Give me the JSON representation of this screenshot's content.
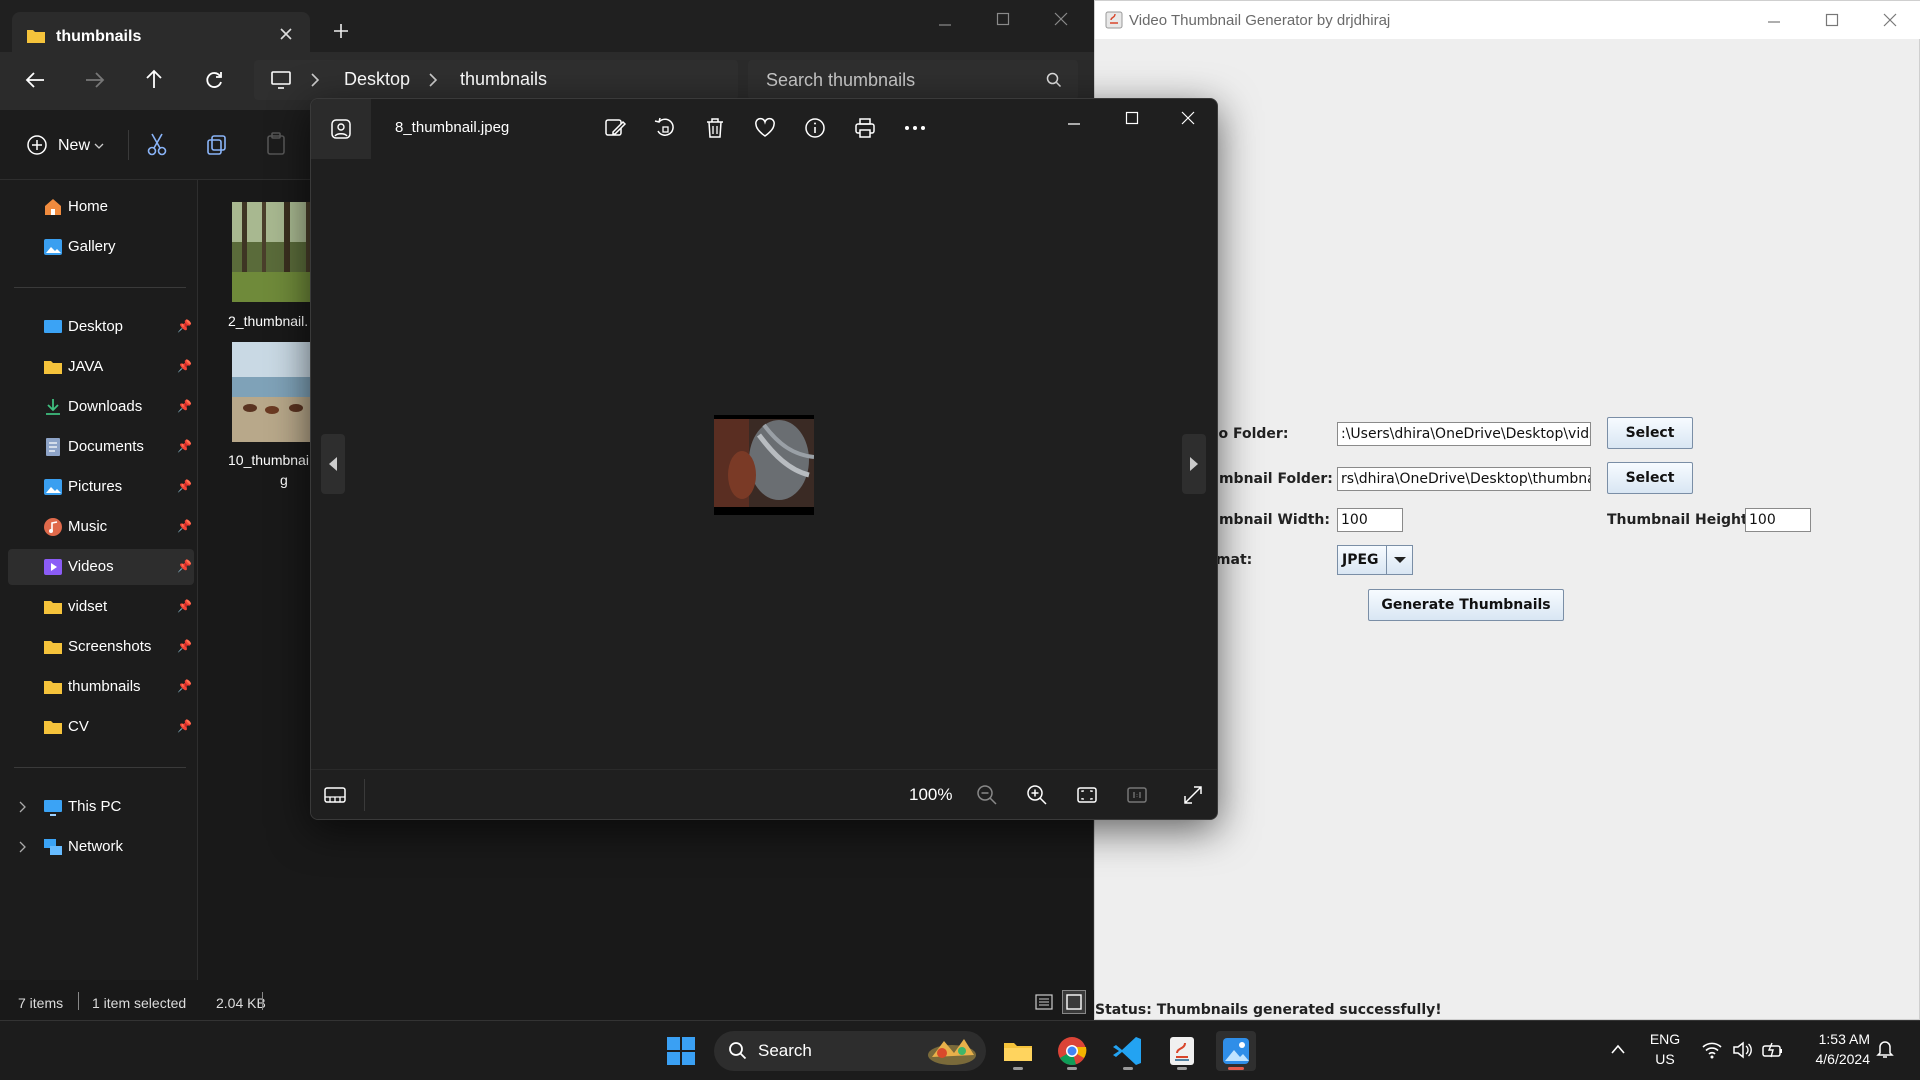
{
  "explorer": {
    "tab_title": "thumbnails",
    "breadcrumb": [
      "Desktop",
      "thumbnails"
    ],
    "search_placeholder": "Search thumbnails",
    "new_label": "New",
    "sidebar": {
      "top": [
        {
          "label": "Home",
          "icon": "home-icon"
        },
        {
          "label": "Gallery",
          "icon": "gallery-icon"
        }
      ],
      "pinned": [
        {
          "label": "Desktop",
          "icon": "desktop-icon"
        },
        {
          "label": "JAVA",
          "icon": "folder-icon"
        },
        {
          "label": "Downloads",
          "icon": "download-icon"
        },
        {
          "label": "Documents",
          "icon": "documents-icon"
        },
        {
          "label": "Pictures",
          "icon": "pictures-icon"
        },
        {
          "label": "Music",
          "icon": "music-icon"
        },
        {
          "label": "Videos",
          "icon": "videos-icon",
          "selected": true
        },
        {
          "label": "vidset",
          "icon": "folder-icon"
        },
        {
          "label": "Screenshots",
          "icon": "folder-icon"
        },
        {
          "label": "thumbnails",
          "icon": "folder-icon"
        },
        {
          "label": "CV",
          "icon": "folder-icon"
        }
      ],
      "bottom": [
        {
          "label": "This PC",
          "icon": "pc-icon"
        },
        {
          "label": "Network",
          "icon": "network-icon"
        }
      ]
    },
    "files": [
      {
        "name": "2_thumbnail.",
        "name2": ""
      },
      {
        "name": "10_thumbnai",
        "name2": "g"
      }
    ],
    "status": {
      "items": "7 items",
      "selected": "1 item selected",
      "size": "2.04 KB"
    }
  },
  "photos": {
    "filename": "8_thumbnail.jpeg",
    "zoom": "100%"
  },
  "java_app": {
    "title": "Video Thumbnail Generator by drjdhiraj",
    "video_folder_label": "eo Folder:",
    "video_folder_value": ":\\Users\\dhira\\OneDrive\\Desktop\\vidset",
    "thumb_folder_label": "umbnail Folder:",
    "thumb_folder_value": "rs\\dhira\\OneDrive\\Desktop\\thumbnails",
    "select_label": "Select",
    "width_label": "umbnail Width:",
    "width_value": "100",
    "height_label": "Thumbnail Height:",
    "height_value": "100",
    "format_label": "rmat:",
    "format_value": "JPEG",
    "generate_label": "Generate Thumbnails",
    "status": "Status: Thumbnails generated successfully!"
  },
  "taskbar": {
    "search_label": "Search",
    "lang_1": "ENG",
    "lang_2": "US",
    "time": "1:53 AM",
    "date": "4/6/2024"
  }
}
